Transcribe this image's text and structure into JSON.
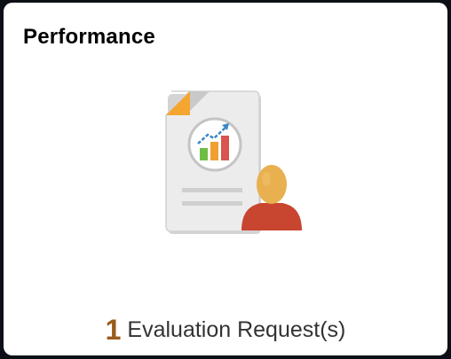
{
  "tile": {
    "title": "Performance",
    "icon": "performance-document-icon",
    "count": "1",
    "count_label": "Evaluation Request(s)"
  },
  "colors": {
    "frame": "#0c0f16",
    "tile_background": "#ffffff",
    "count": "#9a5a1a",
    "document": "#ececec",
    "corner_fold": "#f29b1d",
    "person_head": "#e8b04f",
    "person_body": "#c8452f",
    "chart_green": "#6fbe44",
    "chart_orange": "#f0a030",
    "chart_red": "#d9534f",
    "chart_arrow": "#3b86c7"
  }
}
